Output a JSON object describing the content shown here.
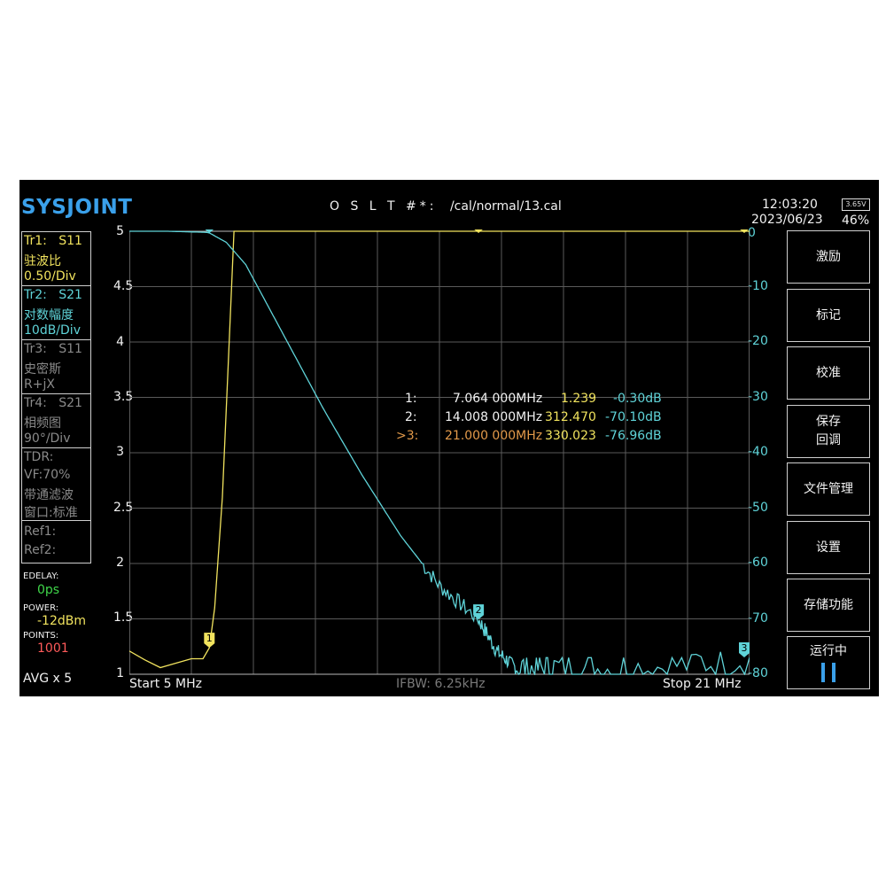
{
  "header": {
    "logo": "SYSJOINT",
    "cal_label": "O S L T #*:",
    "cal_path": "/cal/normal/13.cal",
    "time": "12:03:20",
    "date": "2023/06/23",
    "battery_voltage": "3.65V",
    "battery_percent": "46%"
  },
  "traces": [
    {
      "name": "Tr1:",
      "param": "S11",
      "format": "驻波比",
      "scale": "0.50/Div"
    },
    {
      "name": "Tr2:",
      "param": "S21",
      "format": "对数幅度",
      "scale": "10dB/Div"
    },
    {
      "name": "Tr3:",
      "param": "S11",
      "format": "史密斯",
      "scale": "R+jX"
    },
    {
      "name": "Tr4:",
      "param": "S21",
      "format": "相频图",
      "scale": "90°/Div"
    }
  ],
  "tdr": {
    "label": "TDR:",
    "vf": "VF:70%",
    "mode": "带通滤波",
    "window": "窗口:标准"
  },
  "refs": {
    "ref1": "Ref1:",
    "ref2": "Ref2:"
  },
  "settings": {
    "edelay_label": "EDELAY:",
    "edelay_value": "0ps",
    "power_label": "POWER:",
    "power_value": "-12dBm",
    "points_label": "POINTS:",
    "points_value": "1001",
    "avg": "AVG x 5"
  },
  "softkeys": [
    {
      "label": "激励"
    },
    {
      "label": "标记"
    },
    {
      "label": "校准"
    },
    {
      "label": "保存",
      "label2": "回调"
    },
    {
      "label": "文件管理"
    },
    {
      "label": "设置"
    },
    {
      "label": "存储功能"
    },
    {
      "label": "运行中",
      "icon": "pause-icon"
    }
  ],
  "markers": [
    {
      "id": "1:",
      "freq": "7.064 000MHz",
      "swr": "1.239",
      "db": "-0.30dB"
    },
    {
      "id": "2:",
      "freq": "14.008 000MHz",
      "swr": "312.470",
      "db": "-70.10dB"
    },
    {
      "id": ">3:",
      "freq": "21.000 000MHz",
      "swr": "330.023",
      "db": "-76.96dB"
    }
  ],
  "marker_tags": [
    "1",
    "2",
    "3"
  ],
  "footer": {
    "start": "Start  5 MHz",
    "ifbw": "IFBW: 6.25kHz",
    "stop": "Stop  21 MHz"
  },
  "colors": {
    "swr_trace": "#f1e35e",
    "logmag_trace": "#5fd3d8",
    "active_marker": "#e39a4a",
    "grid": "#5a5a5a"
  },
  "chart_data": {
    "type": "line",
    "x_range_mhz": [
      5,
      21
    ],
    "left_axis": {
      "ticks": [
        "5",
        "4.5",
        "4",
        "3.5",
        "3",
        "2.5",
        "2",
        "1.5",
        "1"
      ],
      "ylim": [
        1,
        5
      ]
    },
    "right_axis": {
      "ticks": [
        "0",
        "-10",
        "-20",
        "-30",
        "-40",
        "-50",
        "-60",
        "-70",
        "-80"
      ],
      "ylim": [
        -80,
        0
      ]
    },
    "grid": true,
    "series": [
      {
        "axis": "left",
        "x": [
          5.0,
          5.4,
          5.8,
          6.2,
          6.6,
          6.9,
          7.064,
          7.2,
          7.4,
          7.55,
          7.7,
          8.0,
          10,
          12,
          14,
          16,
          18,
          21
        ],
        "values": [
          1.21,
          1.13,
          1.06,
          1.1,
          1.14,
          1.14,
          1.239,
          1.6,
          2.6,
          3.8,
          5.0,
          5.0,
          5.0,
          5.0,
          5.0,
          5.0,
          5.0,
          5.0
        ]
      },
      {
        "axis": "right",
        "x": [
          5.0,
          6.0,
          7.0,
          7.064,
          7.5,
          8.0,
          9,
          10,
          11,
          12,
          13,
          14.008,
          14.5,
          15.0,
          16,
          18,
          21
        ],
        "values": [
          0,
          0,
          -0.2,
          -0.3,
          -2,
          -6,
          -19,
          -32,
          -44,
          -55,
          -64,
          -70.1,
          -76,
          -79,
          -79,
          -79,
          -76.96
        ]
      }
    ]
  }
}
